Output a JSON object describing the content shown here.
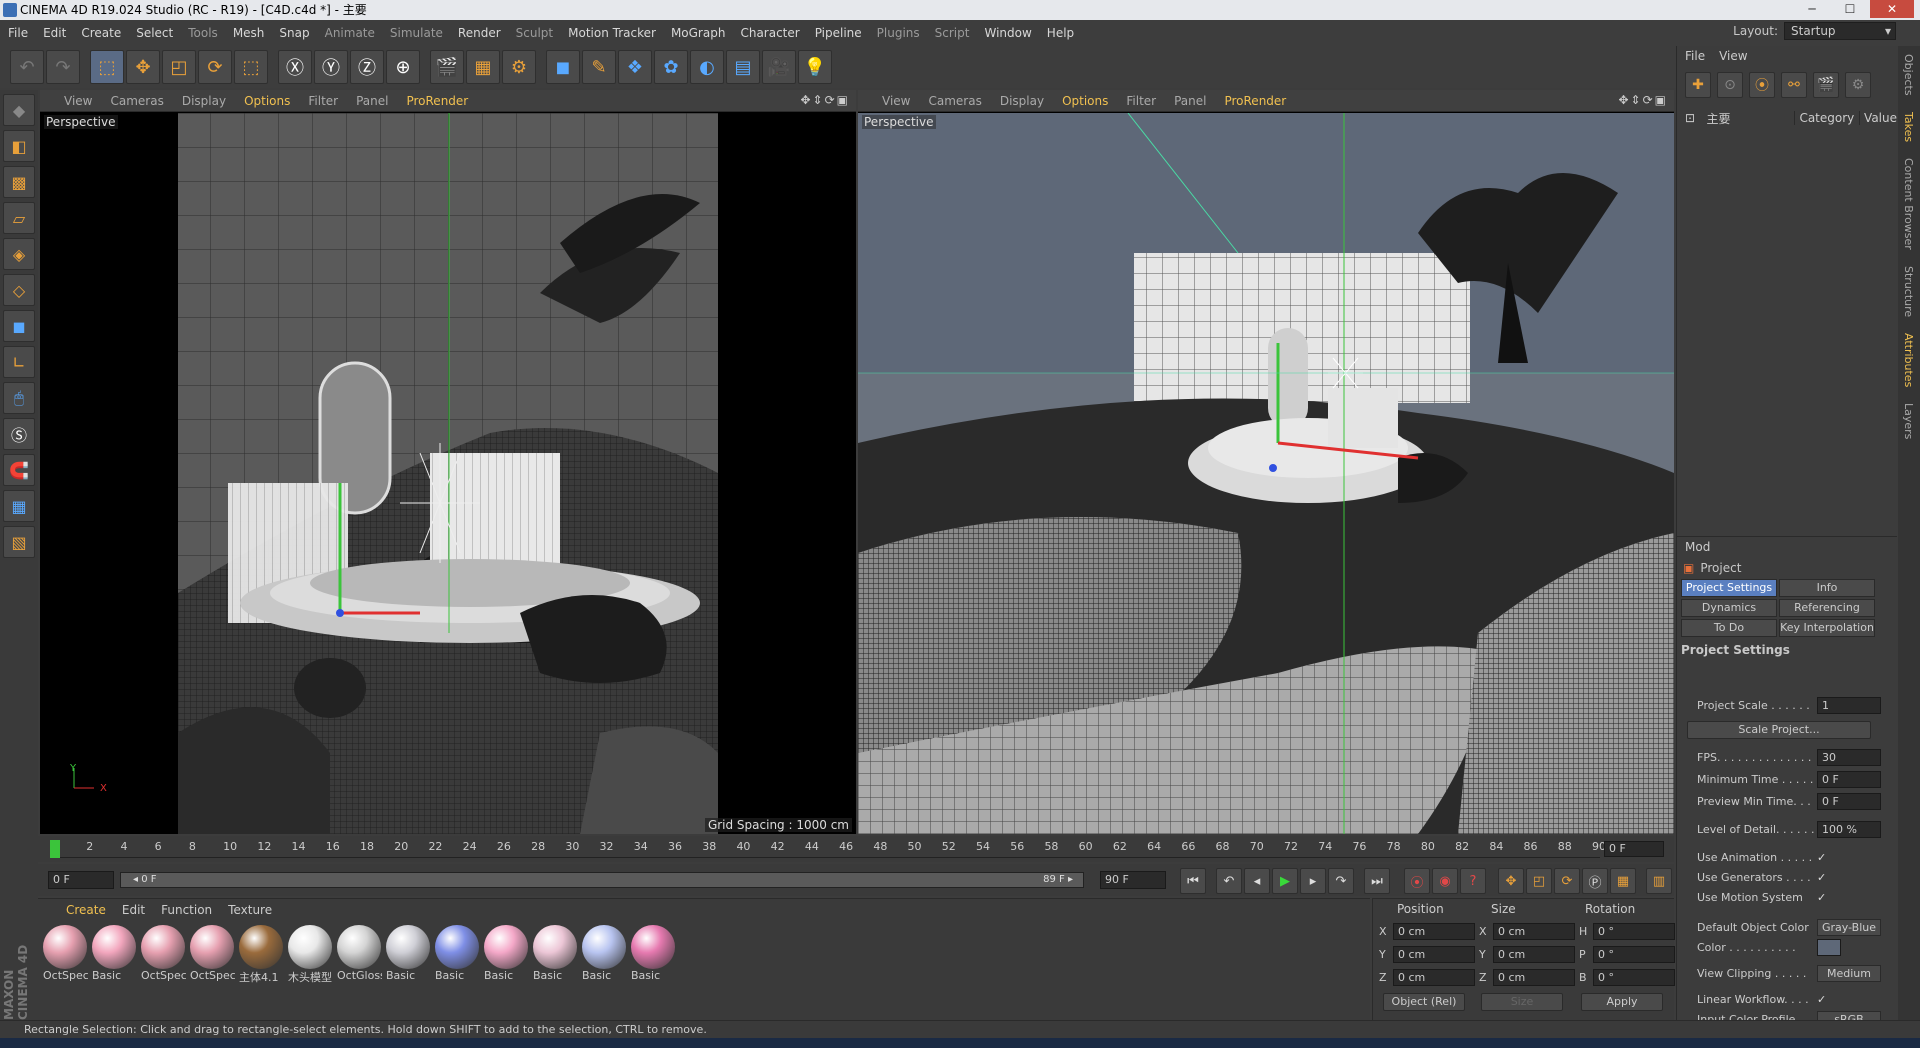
{
  "window": {
    "title": "CINEMA 4D R19.024 Studio (RC - R19) - [C4D.c4d *] - 主要"
  },
  "menu": [
    "File",
    "Edit",
    "Create",
    "Select",
    "Tools",
    "Mesh",
    "Snap",
    "Animate",
    "Simulate",
    "Render",
    "Sculpt",
    "Motion Tracker",
    "MoGraph",
    "Character",
    "Pipeline",
    "Plugins",
    "Script",
    "Window",
    "Help"
  ],
  "layout": {
    "label": "Layout:",
    "value": "Startup"
  },
  "viewport_left": {
    "menu": [
      "View",
      "Cameras",
      "Display",
      "Options",
      "Filter",
      "Panel",
      "ProRender"
    ],
    "label": "Perspective",
    "grid": "Grid Spacing : 1000 cm",
    "axis_y": "Y",
    "axis_x": "X"
  },
  "viewport_right": {
    "menu": [
      "View",
      "Cameras",
      "Display",
      "Options",
      "Filter",
      "Panel",
      "ProRender"
    ],
    "label": "Perspective"
  },
  "timeline": {
    "ticks": [
      "0",
      "2",
      "4",
      "6",
      "8",
      "10",
      "12",
      "14",
      "16",
      "18",
      "20",
      "22",
      "24",
      "26",
      "28",
      "30",
      "32",
      "34",
      "36",
      "38",
      "40",
      "42",
      "44",
      "46",
      "48",
      "50",
      "52",
      "54",
      "56",
      "58",
      "60",
      "62",
      "64",
      "66",
      "68",
      "70",
      "72",
      "74",
      "76",
      "78",
      "80",
      "82",
      "84",
      "86",
      "88",
      "90"
    ],
    "frame": "0 F",
    "start": "0 F",
    "range_start": "◂ 0 F",
    "range_end": "89 F ▸",
    "end": "90 F"
  },
  "materials": {
    "menu": [
      "Create",
      "Edit",
      "Function",
      "Texture"
    ],
    "items": [
      {
        "name": "OctSpec",
        "color": "#e6a0b0"
      },
      {
        "name": "Basic",
        "color": "#f2a6bd"
      },
      {
        "name": "OctSpec",
        "color": "#e6a0b0"
      },
      {
        "name": "OctSpec",
        "color": "#e6a0b0"
      },
      {
        "name": "主体4.1",
        "color": "#9a6b3c"
      },
      {
        "name": "木头模型",
        "color": "#e8e8e8"
      },
      {
        "name": "OctGloss",
        "color": "#d4d4d4"
      },
      {
        "name": "Basic",
        "color": "#cfcfd6"
      },
      {
        "name": "Basic",
        "color": "#7f8fe6"
      },
      {
        "name": "Basic",
        "color": "#f4a8c8"
      },
      {
        "name": "Basic",
        "color": "#ecc6d6"
      },
      {
        "name": "Basic",
        "color": "#b8c4f0"
      },
      {
        "name": "Basic",
        "color": "#e67ab0"
      }
    ]
  },
  "coords": {
    "headers": [
      "Position",
      "Size",
      "Rotation"
    ],
    "rows": [
      {
        "a": "X",
        "p": "0 cm",
        "b": "X",
        "s": "0 cm",
        "c": "H",
        "r": "0 °"
      },
      {
        "a": "Y",
        "p": "0 cm",
        "b": "Y",
        "s": "0 cm",
        "c": "P",
        "r": "0 °"
      },
      {
        "a": "Z",
        "p": "0 cm",
        "b": "Z",
        "s": "0 cm",
        "c": "B",
        "r": "0 °"
      }
    ],
    "mode": "Object (Rel)",
    "size_mode": "Size",
    "apply": "Apply"
  },
  "objects": {
    "menu": [
      "File",
      "View"
    ],
    "layer": "主要",
    "cols": [
      "Category",
      "Value"
    ]
  },
  "attributes": {
    "menu": "Mod",
    "title": "Project",
    "tabs": [
      "Project Settings",
      "Info",
      "Dynamics",
      "Referencing",
      "To Do",
      "Key Interpolation"
    ],
    "section": "Project Settings",
    "rows": [
      {
        "label": "Project Scale . . . . . .",
        "value": "1"
      },
      {
        "label": "FPS. . . . . . . . . . . . . .",
        "value": "30"
      },
      {
        "label": "Minimum Time . . . . .",
        "value": "0 F"
      },
      {
        "label": "Preview Min Time. . .",
        "value": "0 F"
      },
      {
        "label": "Level of Detail. . . . . .",
        "value": "100 %"
      },
      {
        "label": "Use Animation . . . . .",
        "value": "✓"
      },
      {
        "label": "Use Generators . . . .",
        "value": "✓"
      },
      {
        "label": "Use Motion System",
        "value": "✓"
      },
      {
        "label": "Default Object Color",
        "value": "Gray-Blue"
      },
      {
        "label": "Color . . . . . . . . . .",
        "value": ""
      },
      {
        "label": "View Clipping . . . . .",
        "value": "Medium"
      },
      {
        "label": "Linear Workflow. . . .",
        "value": "✓"
      },
      {
        "label": "Input Color Profile . .",
        "value": "sRGB"
      }
    ],
    "scale_btn": "Scale Project..."
  },
  "sidetabs": [
    "Objects",
    "Takes",
    "Content Browser",
    "Structure",
    "Attributes",
    "Layers"
  ],
  "status": "Rectangle Selection: Click and drag to rectangle-select elements. Hold down SHIFT to add to the selection, CTRL to remove.",
  "logo": "MAXON CINEMA 4D"
}
